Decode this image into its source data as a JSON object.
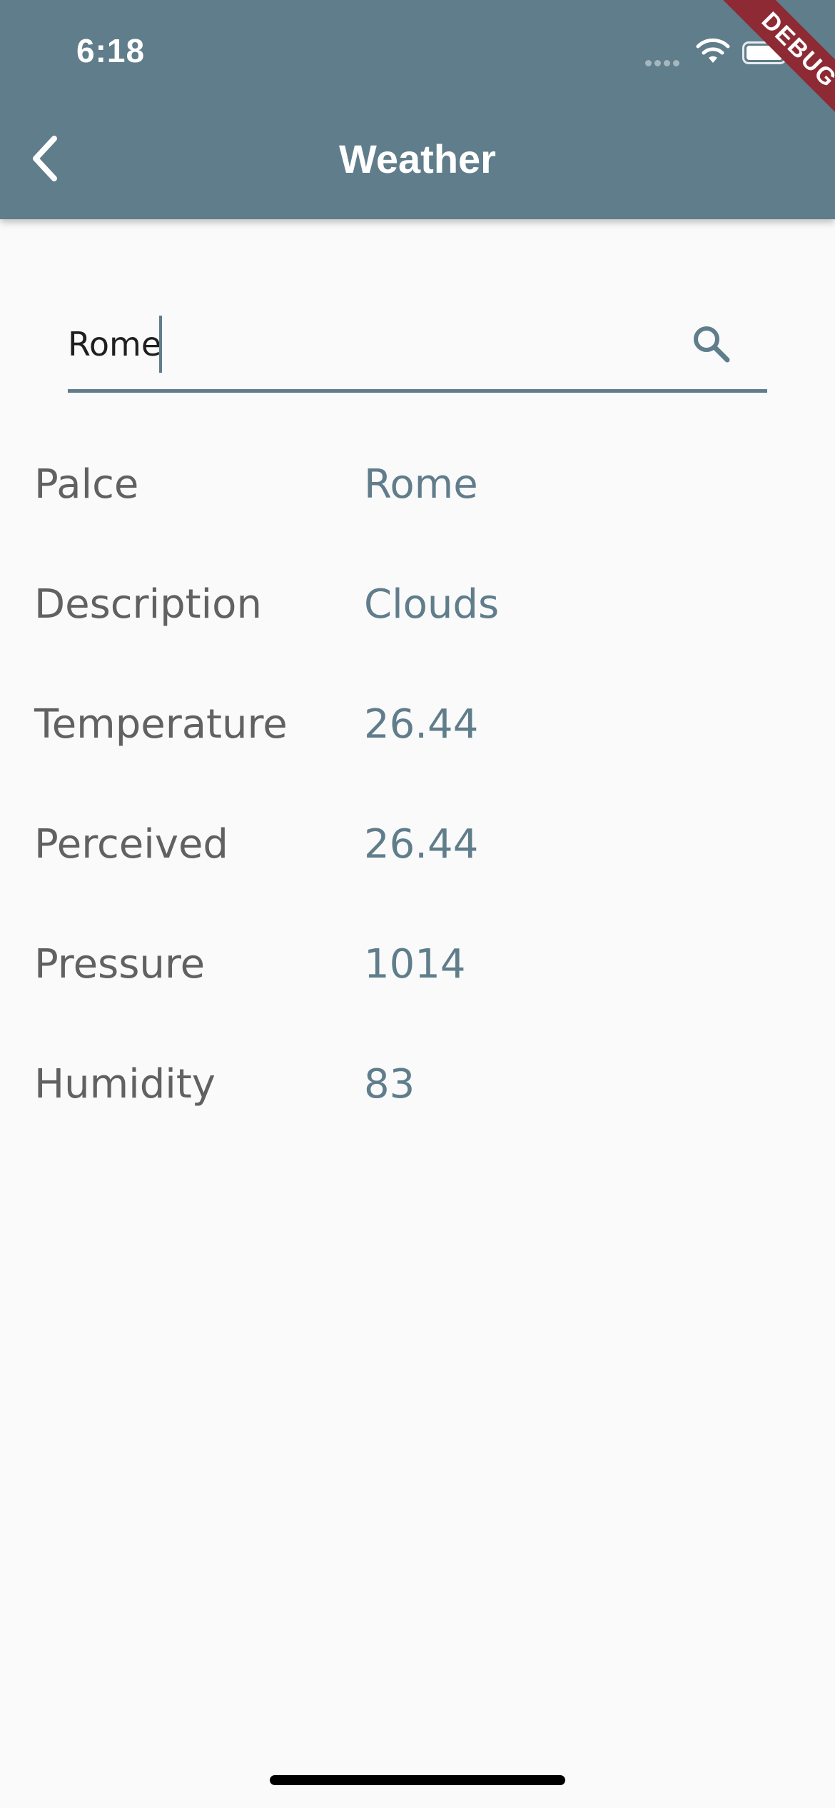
{
  "status_bar": {
    "time": "6:18"
  },
  "app_bar": {
    "title": "Weather",
    "debug_banner": "DEBUG"
  },
  "search": {
    "value": "Rome"
  },
  "details": [
    {
      "label": "Palce",
      "value": "Rome"
    },
    {
      "label": "Description",
      "value": "Clouds"
    },
    {
      "label": "Temperature",
      "value": "26.44"
    },
    {
      "label": "Perceived",
      "value": "26.44"
    },
    {
      "label": "Pressure",
      "value": "1014"
    },
    {
      "label": "Humidity",
      "value": "83"
    }
  ],
  "colors": {
    "app_bar": "#607d8b",
    "background": "#fafafa",
    "label_text": "#616161",
    "value_text": "#607d8b",
    "debug_banner": "#8e2a33"
  },
  "icons": {
    "back": "chevron-left-icon",
    "search": "search-icon",
    "wifi": "wifi-icon",
    "battery": "battery-icon",
    "signal": "signal-icon"
  }
}
